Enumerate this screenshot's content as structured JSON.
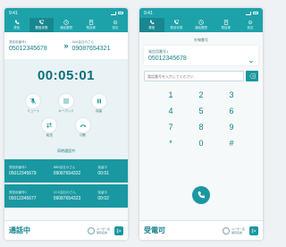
{
  "colors": {
    "primary": "#1ea2aa",
    "primary_dark": "#18878f",
    "text_accent": "#12808a",
    "background": "#eef2f4"
  },
  "statusbar": {
    "time": "9:41"
  },
  "nav": {
    "items": [
      {
        "label": "発信",
        "icon": "phone-icon"
      },
      {
        "label": "着信状態",
        "icon": "incoming-call-icon"
      },
      {
        "label": "通話履歴",
        "icon": "history-icon"
      },
      {
        "label": "電話帳",
        "icon": "contacts-icon"
      },
      {
        "label": "設定",
        "icon": "gear-icon"
      }
    ]
  },
  "left": {
    "caller": {
      "label": "発信用番号1",
      "number": "05012345678"
    },
    "callee": {
      "label": "AAA会社のさん",
      "number": "09087654321"
    },
    "timer": "00:05:01",
    "controls": [
      {
        "label": "ミュート",
        "icon": "mute-icon"
      },
      {
        "label": "キーパッド",
        "icon": "keypad-icon"
      },
      {
        "label": "保留",
        "icon": "hold-icon"
      },
      {
        "label": "転送",
        "icon": "transfer-icon"
      },
      {
        "label": "切断",
        "icon": "hangup-icon"
      }
    ],
    "hold_list_title": "同時通話中",
    "hold_calls": [
      {
        "line_label": "発信用番号2",
        "line_number": "05012345679",
        "party_label": "BBB会社のさん",
        "party_number": "09087654322",
        "status": "保留中",
        "time": "00:01"
      },
      {
        "line_label": "発信用番号3",
        "line_number": "05012345677",
        "party_label": "CCC会社のさん",
        "party_number": "09087654323",
        "status": "保留中",
        "time": "00:02"
      }
    ],
    "bottom": {
      "status": "通話中",
      "user_name": "ユーザー名",
      "user_sub": "保存名前"
    }
  },
  "right": {
    "section_label": "外線番号",
    "line": {
      "label": "発信用番号1",
      "number": "05012345678"
    },
    "phone_input_placeholder": "電話番号を入力してください",
    "keys": [
      "1",
      "2",
      "3",
      "4",
      "5",
      "6",
      "7",
      "8",
      "9",
      "*",
      "0",
      "#"
    ],
    "bottom": {
      "status": "受電可",
      "user_name": "ユーザー名",
      "user_sub": "保存名前"
    }
  }
}
